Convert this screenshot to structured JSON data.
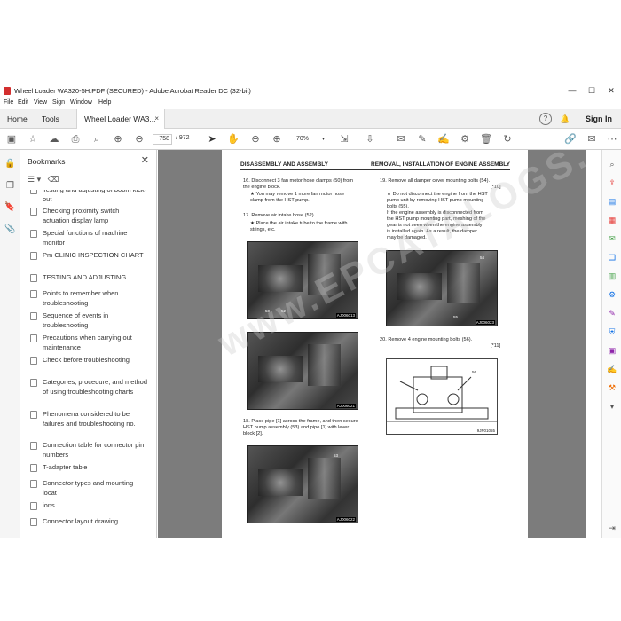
{
  "window": {
    "title": "Wheel Loader WA320-5H.PDF (SECURED) - Adobe Acrobat Reader DC (32-bit)",
    "minimize": "—",
    "maximize": "☐",
    "close": "✕"
  },
  "menu": [
    "File",
    "Edit",
    "View",
    "Sign",
    "Window",
    "Help"
  ],
  "tabs": {
    "home": "Home",
    "tools": "Tools",
    "document": "Wheel Loader WA3...",
    "document_close": "×",
    "sign_in": "Sign In"
  },
  "toolbar": {
    "current_page": "758",
    "total_pages": "/ 972",
    "zoom": "70%"
  },
  "bookmarks": {
    "title": "Bookmarks",
    "items": [
      "Testing and adjusting of boom kick-out",
      "Checking proximity switch actuation display lamp",
      "Special functions of machine monitor",
      "Pm CLINIC INSPECTION CHART",
      "TESTING AND ADJUSTING",
      "Points to remember when troubleshooting",
      "Sequence of events in troubleshooting",
      "Precautions when carrying out maintenance",
      "Check before troubleshooting",
      "Categories, procedure, and method of using troubleshooting charts",
      "Phenomena considered to be failures and troubleshooting no.",
      "Connection table for connector pin numbers",
      "T-adapter table",
      "Connector types and mounting locat",
      "ions",
      "Connector layout drawing"
    ]
  },
  "page": {
    "header_left": "DISASSEMBLY AND ASSEMBLY",
    "header_right": "REMOVAL, INSTALLATION OF ENGINE ASSEMBLY",
    "step16": "16. Disconnect 3 fan motor hose clamps (50) from\n      the engine block.",
    "step16_note": "★  You may remove 1 more fan motor hose\n    clamp from the HST pump.",
    "step17": "17. Remove air intake hose (52).",
    "step17_note": "★  Place the air intake tube to the frame with\n    strings, etc.",
    "step18": "18. Place pipe [1] across the frame, and then secure\n      HST pump assembly (53) and pipe [1] with lever\n      block [2].",
    "step19": "19. Remove all damper cover mounting bolts (54).",
    "step19_ref": "[*10]",
    "step19_note": "★  Do not disconnect the engine from the HST\n    pump unit by removing HST pump mounting\n    bolts (55).\n    If the engine assembly is disconnected from\n    the HST pump mounting part, meshing of the\n    gear is not seen when the engine assembly\n    is installed again.  As a result, the damper\n    may be damaged.",
    "step20": "20. Remove 4 engine mounting bolts (56).",
    "step20_ref": "[*11]",
    "photo_codes": [
      "AJ006013",
      "AJ006021",
      "AJ006022",
      "AJ006023",
      "9JP01055"
    ],
    "photo_tags": [
      "50",
      "52",
      "53",
      "54",
      "55",
      "56"
    ],
    "watermark": "www.EPCATALOGS.COM"
  },
  "colors": {
    "accent": "#1473e6",
    "doc_background": "#7c7c7c",
    "tab_bar": "#f0f0f0"
  }
}
